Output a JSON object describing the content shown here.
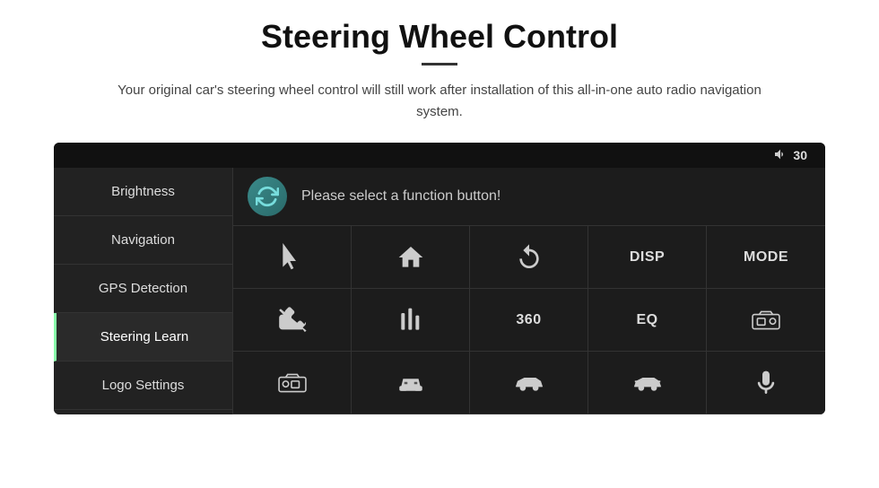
{
  "page": {
    "title": "Steering Wheel Control",
    "subtitle": "Your original car's steering wheel control will still work after installation of this all-in-one auto radio navigation system.",
    "divider": true
  },
  "status_bar": {
    "volume_label": "30"
  },
  "sidebar": {
    "items": [
      {
        "id": "brightness",
        "label": "Brightness",
        "active": false
      },
      {
        "id": "navigation",
        "label": "Navigation",
        "active": false
      },
      {
        "id": "gps-detection",
        "label": "GPS Detection",
        "active": false
      },
      {
        "id": "steering-learn",
        "label": "Steering Learn",
        "active": true
      },
      {
        "id": "logo-settings",
        "label": "Logo Settings",
        "active": false
      }
    ]
  },
  "top_bar": {
    "prompt": "Please select a function button!"
  },
  "grid": {
    "cells": [
      {
        "id": "cursor",
        "type": "cursor",
        "label": ""
      },
      {
        "id": "home",
        "type": "home-icon",
        "label": ""
      },
      {
        "id": "back",
        "type": "back-icon",
        "label": ""
      },
      {
        "id": "disp",
        "type": "text",
        "label": "DISP"
      },
      {
        "id": "mode",
        "type": "text",
        "label": "MODE"
      },
      {
        "id": "no-call",
        "type": "no-call-icon",
        "label": ""
      },
      {
        "id": "equalizer",
        "type": "eq-icon",
        "label": ""
      },
      {
        "id": "360",
        "type": "text",
        "label": "360"
      },
      {
        "id": "eq-text",
        "type": "text",
        "label": "EQ"
      },
      {
        "id": "camera-1",
        "type": "camera-icon",
        "label": ""
      },
      {
        "id": "camera-2",
        "type": "camera-icon-2",
        "label": ""
      },
      {
        "id": "car-front",
        "type": "car-front-icon",
        "label": ""
      },
      {
        "id": "car-side",
        "type": "car-side-icon",
        "label": ""
      },
      {
        "id": "car-side-2",
        "type": "car-side-2-icon",
        "label": ""
      },
      {
        "id": "mic",
        "type": "mic-icon",
        "label": ""
      }
    ]
  }
}
